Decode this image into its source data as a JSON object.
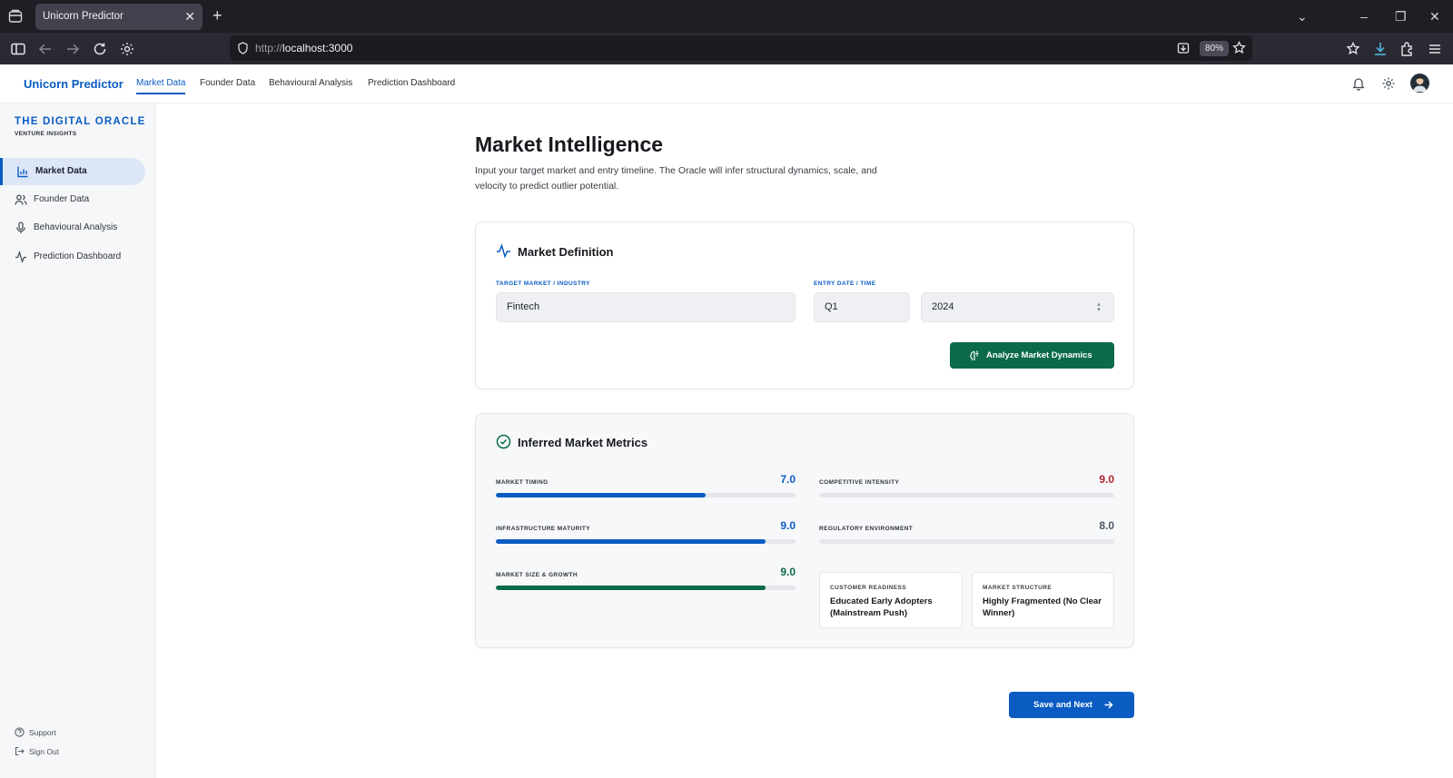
{
  "browser": {
    "tab_title": "Unicorn Predictor",
    "url_prefix": "http://",
    "url_host": "localhost:3000",
    "zoom": "80%"
  },
  "header": {
    "brand": "Unicorn Predictor",
    "nav": [
      {
        "label": "Market Data",
        "active": true
      },
      {
        "label": "Founder Data",
        "active": false
      },
      {
        "label": "Behavioural Analysis",
        "active": false
      },
      {
        "label": "Prediction Dashboard",
        "active": false
      }
    ]
  },
  "sidebar": {
    "title": "THE DIGITAL ORACLE",
    "subtitle": "VENTURE INSIGHTS",
    "items": [
      {
        "label": "Market Data",
        "icon": "bar-chart-icon",
        "active": true
      },
      {
        "label": "Founder Data",
        "icon": "users-icon",
        "active": false
      },
      {
        "label": "Behavioural Analysis",
        "icon": "microphone-icon",
        "active": false
      },
      {
        "label": "Prediction Dashboard",
        "icon": "activity-icon",
        "active": false
      }
    ],
    "footer": {
      "support": "Support",
      "sign_out": "Sign Out"
    }
  },
  "main": {
    "title": "Market Intelligence",
    "description": "Input your target market and entry timeline. The Oracle will infer structural dynamics, scale, and velocity to predict outlier potential.",
    "definition": {
      "title": "Market Definition",
      "market_label": "TARGET MARKET / INDUSTRY",
      "market_value": "Fintech",
      "date_label": "ENTRY DATE / TIME",
      "quarter_value": "Q1",
      "year_value": "2024",
      "analyze_button": "Analyze Market Dynamics"
    },
    "metrics": {
      "title": "Inferred Market Metrics",
      "market_timing": {
        "label": "MARKET TIMING",
        "value": "7.0",
        "fraction": 0.7,
        "color": "#0a5cc2"
      },
      "infrastructure_maturity": {
        "label": "INFRASTRUCTURE MATURITY",
        "value": "9.0",
        "fraction": 0.9,
        "color": "#0a5cc2"
      },
      "market_size_growth": {
        "label": "MARKET SIZE & GROWTH",
        "value": "9.0",
        "fraction": 0.9,
        "color": "#0b6a4b"
      },
      "competitive_intensity": {
        "label": "COMPETITIVE INTENSITY",
        "value": "9.0",
        "fraction": 0.0,
        "color": "#b0242e"
      },
      "regulatory_environment": {
        "label": "REGULATORY ENVIRONMENT",
        "value": "8.0",
        "fraction": 0.0,
        "color": "#4b5563"
      },
      "customer_readiness": {
        "label": "CUSTOMER READINESS",
        "value": "Educated Early Adopters (Mainstream Push)"
      },
      "market_structure": {
        "label": "MARKET STRUCTURE",
        "value": "Highly Fragmented (No Clear Winner)"
      }
    },
    "save_button": "Save and Next"
  },
  "colors": {
    "primary": "#0a5cc2",
    "success": "#0b6a4b",
    "danger": "#b0242e"
  }
}
